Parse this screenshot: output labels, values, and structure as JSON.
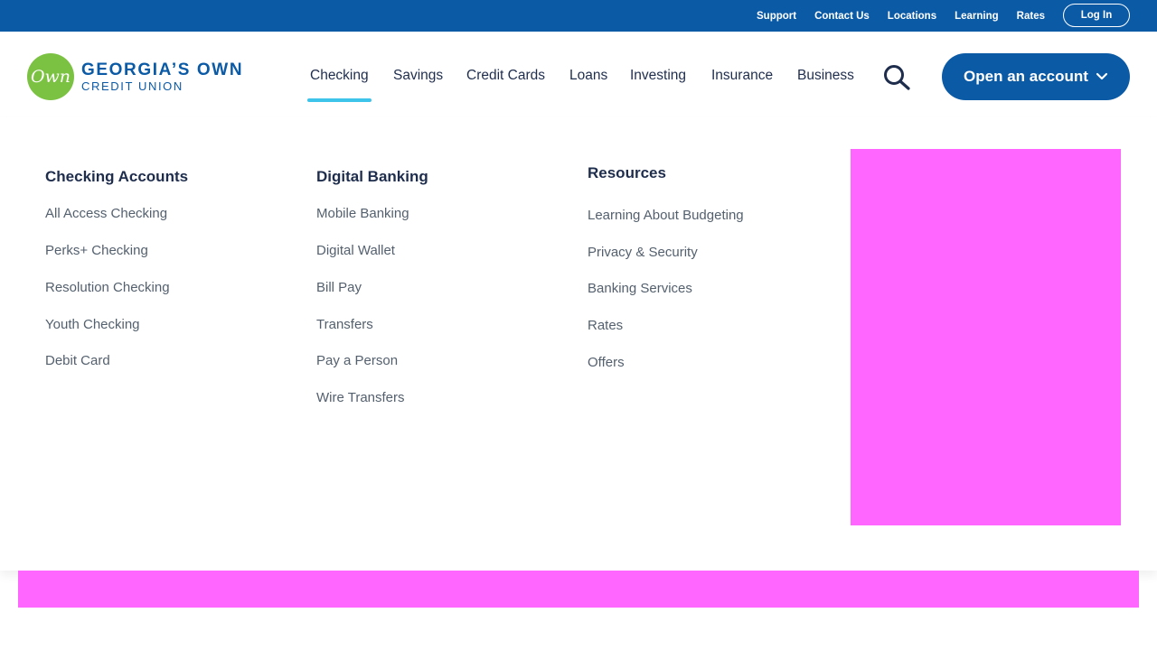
{
  "utility": {
    "links": [
      "Support",
      "Contact Us",
      "Locations",
      "Learning",
      "Rates"
    ],
    "login": "Log In"
  },
  "logo": {
    "badge": "Own",
    "line1": "GEORGIA’S OWN",
    "line2": "CREDIT UNION"
  },
  "nav": {
    "items": [
      "Checking",
      "Savings",
      "Credit Cards",
      "Loans",
      "Investing",
      "Insurance",
      "Business"
    ],
    "active": "Checking",
    "search_icon": "search-icon",
    "open_account": "Open an account",
    "open_account_icon": "chevron-down-icon"
  },
  "menu": {
    "checking": {
      "title": "Checking Accounts",
      "items": [
        "All Access Checking",
        "Perks+ Checking",
        "Resolution Checking",
        "Youth Checking",
        "Debit Card"
      ]
    },
    "digital": {
      "title": "Digital Banking",
      "items": [
        "Mobile Banking",
        "Digital Wallet",
        "Bill Pay",
        "Transfers",
        "Pay a Person",
        "Wire Transfers"
      ]
    },
    "resources": {
      "title": "Resources",
      "items": [
        "Learning About Budgeting",
        "Privacy & Security",
        "Banking Services",
        "Rates",
        "Offers"
      ]
    }
  },
  "colors": {
    "brand_blue": "#0b5aa6",
    "accent_cyan": "#3ec3ea",
    "logo_green": "#7cc242",
    "placeholder_magenta": "#ff66ff"
  }
}
